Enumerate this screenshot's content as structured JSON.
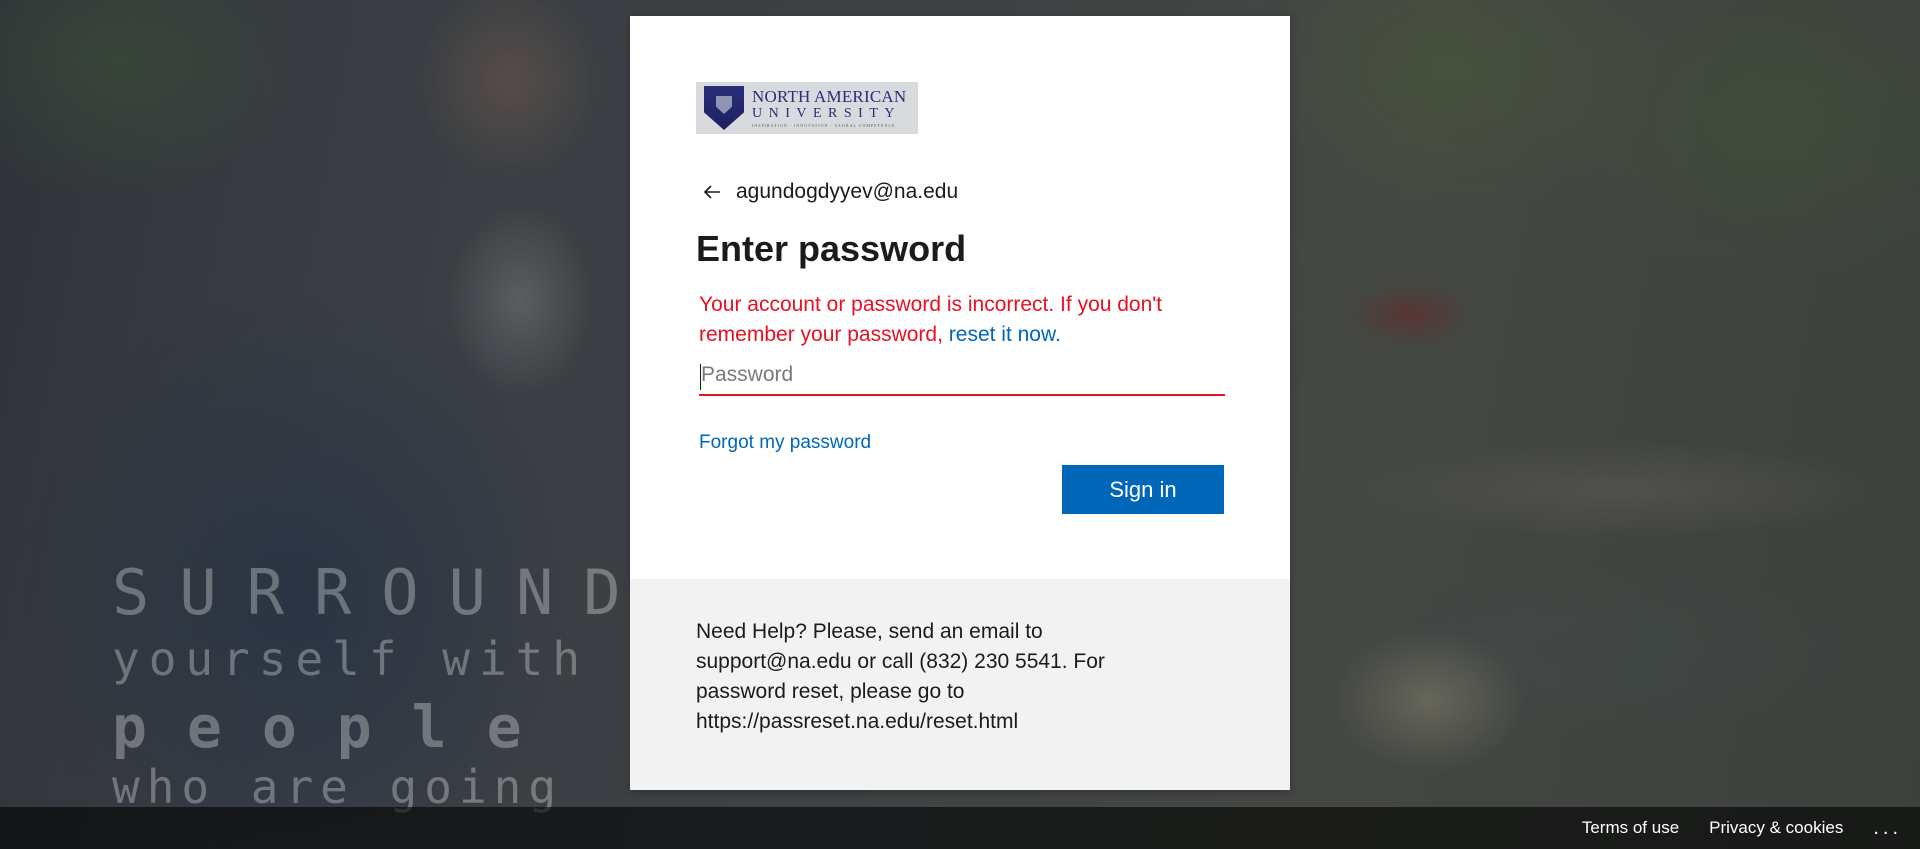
{
  "background": {
    "slogan_lines": [
      "SURROUND",
      "yourself with",
      "people",
      "who are going"
    ]
  },
  "card": {
    "logo": {
      "line1": "NORTH AMERICAN",
      "line2": "UNIVERSITY",
      "tagline": "INSPIRATION · INNOVATION · GLOBAL COMPETENCE"
    },
    "identity": "agundogdyyev@na.edu",
    "title": "Enter password",
    "error_text": "Your account or password is incorrect. If you don't remember your password, ",
    "error_link": "reset it now.",
    "password_placeholder": "Password",
    "forgot_link": "Forgot my password",
    "signin_label": "Sign in",
    "help_text": "Need Help? Please, send an email to support@na.edu or call (832) 230 5541. For password reset, please go to https://passreset.na.edu/reset.html"
  },
  "footer": {
    "terms": "Terms of use",
    "privacy": "Privacy & cookies",
    "more": "..."
  },
  "colors": {
    "accent": "#0067b8",
    "error": "#e81123"
  }
}
